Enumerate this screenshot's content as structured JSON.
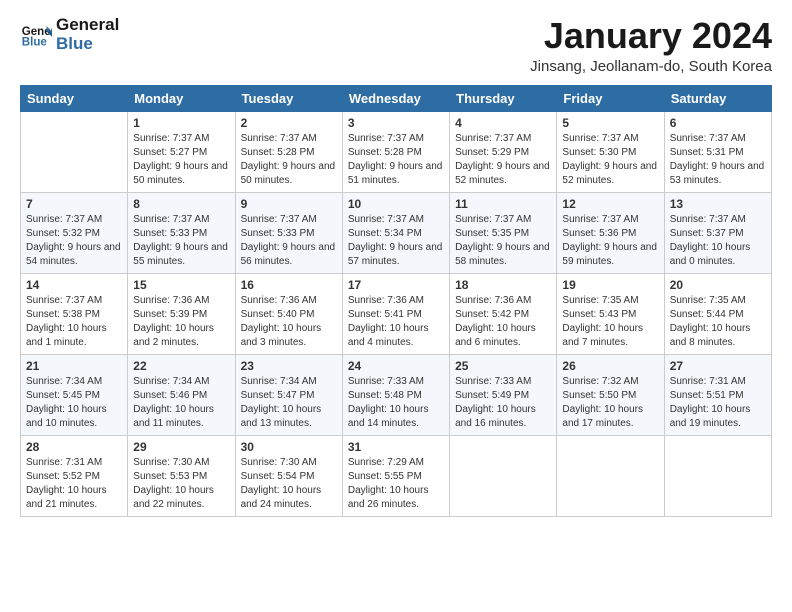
{
  "header": {
    "logo_line1": "General",
    "logo_line2": "Blue",
    "title": "January 2024",
    "subtitle": "Jinsang, Jeollanam-do, South Korea"
  },
  "days_of_week": [
    "Sunday",
    "Monday",
    "Tuesday",
    "Wednesday",
    "Thursday",
    "Friday",
    "Saturday"
  ],
  "weeks": [
    [
      {
        "day": "",
        "sunrise": "",
        "sunset": "",
        "daylight": ""
      },
      {
        "day": "1",
        "sunrise": "Sunrise: 7:37 AM",
        "sunset": "Sunset: 5:27 PM",
        "daylight": "Daylight: 9 hours and 50 minutes."
      },
      {
        "day": "2",
        "sunrise": "Sunrise: 7:37 AM",
        "sunset": "Sunset: 5:28 PM",
        "daylight": "Daylight: 9 hours and 50 minutes."
      },
      {
        "day": "3",
        "sunrise": "Sunrise: 7:37 AM",
        "sunset": "Sunset: 5:28 PM",
        "daylight": "Daylight: 9 hours and 51 minutes."
      },
      {
        "day": "4",
        "sunrise": "Sunrise: 7:37 AM",
        "sunset": "Sunset: 5:29 PM",
        "daylight": "Daylight: 9 hours and 52 minutes."
      },
      {
        "day": "5",
        "sunrise": "Sunrise: 7:37 AM",
        "sunset": "Sunset: 5:30 PM",
        "daylight": "Daylight: 9 hours and 52 minutes."
      },
      {
        "day": "6",
        "sunrise": "Sunrise: 7:37 AM",
        "sunset": "Sunset: 5:31 PM",
        "daylight": "Daylight: 9 hours and 53 minutes."
      }
    ],
    [
      {
        "day": "7",
        "sunrise": "Sunrise: 7:37 AM",
        "sunset": "Sunset: 5:32 PM",
        "daylight": "Daylight: 9 hours and 54 minutes."
      },
      {
        "day": "8",
        "sunrise": "Sunrise: 7:37 AM",
        "sunset": "Sunset: 5:33 PM",
        "daylight": "Daylight: 9 hours and 55 minutes."
      },
      {
        "day": "9",
        "sunrise": "Sunrise: 7:37 AM",
        "sunset": "Sunset: 5:33 PM",
        "daylight": "Daylight: 9 hours and 56 minutes."
      },
      {
        "day": "10",
        "sunrise": "Sunrise: 7:37 AM",
        "sunset": "Sunset: 5:34 PM",
        "daylight": "Daylight: 9 hours and 57 minutes."
      },
      {
        "day": "11",
        "sunrise": "Sunrise: 7:37 AM",
        "sunset": "Sunset: 5:35 PM",
        "daylight": "Daylight: 9 hours and 58 minutes."
      },
      {
        "day": "12",
        "sunrise": "Sunrise: 7:37 AM",
        "sunset": "Sunset: 5:36 PM",
        "daylight": "Daylight: 9 hours and 59 minutes."
      },
      {
        "day": "13",
        "sunrise": "Sunrise: 7:37 AM",
        "sunset": "Sunset: 5:37 PM",
        "daylight": "Daylight: 10 hours and 0 minutes."
      }
    ],
    [
      {
        "day": "14",
        "sunrise": "Sunrise: 7:37 AM",
        "sunset": "Sunset: 5:38 PM",
        "daylight": "Daylight: 10 hours and 1 minute."
      },
      {
        "day": "15",
        "sunrise": "Sunrise: 7:36 AM",
        "sunset": "Sunset: 5:39 PM",
        "daylight": "Daylight: 10 hours and 2 minutes."
      },
      {
        "day": "16",
        "sunrise": "Sunrise: 7:36 AM",
        "sunset": "Sunset: 5:40 PM",
        "daylight": "Daylight: 10 hours and 3 minutes."
      },
      {
        "day": "17",
        "sunrise": "Sunrise: 7:36 AM",
        "sunset": "Sunset: 5:41 PM",
        "daylight": "Daylight: 10 hours and 4 minutes."
      },
      {
        "day": "18",
        "sunrise": "Sunrise: 7:36 AM",
        "sunset": "Sunset: 5:42 PM",
        "daylight": "Daylight: 10 hours and 6 minutes."
      },
      {
        "day": "19",
        "sunrise": "Sunrise: 7:35 AM",
        "sunset": "Sunset: 5:43 PM",
        "daylight": "Daylight: 10 hours and 7 minutes."
      },
      {
        "day": "20",
        "sunrise": "Sunrise: 7:35 AM",
        "sunset": "Sunset: 5:44 PM",
        "daylight": "Daylight: 10 hours and 8 minutes."
      }
    ],
    [
      {
        "day": "21",
        "sunrise": "Sunrise: 7:34 AM",
        "sunset": "Sunset: 5:45 PM",
        "daylight": "Daylight: 10 hours and 10 minutes."
      },
      {
        "day": "22",
        "sunrise": "Sunrise: 7:34 AM",
        "sunset": "Sunset: 5:46 PM",
        "daylight": "Daylight: 10 hours and 11 minutes."
      },
      {
        "day": "23",
        "sunrise": "Sunrise: 7:34 AM",
        "sunset": "Sunset: 5:47 PM",
        "daylight": "Daylight: 10 hours and 13 minutes."
      },
      {
        "day": "24",
        "sunrise": "Sunrise: 7:33 AM",
        "sunset": "Sunset: 5:48 PM",
        "daylight": "Daylight: 10 hours and 14 minutes."
      },
      {
        "day": "25",
        "sunrise": "Sunrise: 7:33 AM",
        "sunset": "Sunset: 5:49 PM",
        "daylight": "Daylight: 10 hours and 16 minutes."
      },
      {
        "day": "26",
        "sunrise": "Sunrise: 7:32 AM",
        "sunset": "Sunset: 5:50 PM",
        "daylight": "Daylight: 10 hours and 17 minutes."
      },
      {
        "day": "27",
        "sunrise": "Sunrise: 7:31 AM",
        "sunset": "Sunset: 5:51 PM",
        "daylight": "Daylight: 10 hours and 19 minutes."
      }
    ],
    [
      {
        "day": "28",
        "sunrise": "Sunrise: 7:31 AM",
        "sunset": "Sunset: 5:52 PM",
        "daylight": "Daylight: 10 hours and 21 minutes."
      },
      {
        "day": "29",
        "sunrise": "Sunrise: 7:30 AM",
        "sunset": "Sunset: 5:53 PM",
        "daylight": "Daylight: 10 hours and 22 minutes."
      },
      {
        "day": "30",
        "sunrise": "Sunrise: 7:30 AM",
        "sunset": "Sunset: 5:54 PM",
        "daylight": "Daylight: 10 hours and 24 minutes."
      },
      {
        "day": "31",
        "sunrise": "Sunrise: 7:29 AM",
        "sunset": "Sunset: 5:55 PM",
        "daylight": "Daylight: 10 hours and 26 minutes."
      },
      {
        "day": "",
        "sunrise": "",
        "sunset": "",
        "daylight": ""
      },
      {
        "day": "",
        "sunrise": "",
        "sunset": "",
        "daylight": ""
      },
      {
        "day": "",
        "sunrise": "",
        "sunset": "",
        "daylight": ""
      }
    ]
  ]
}
